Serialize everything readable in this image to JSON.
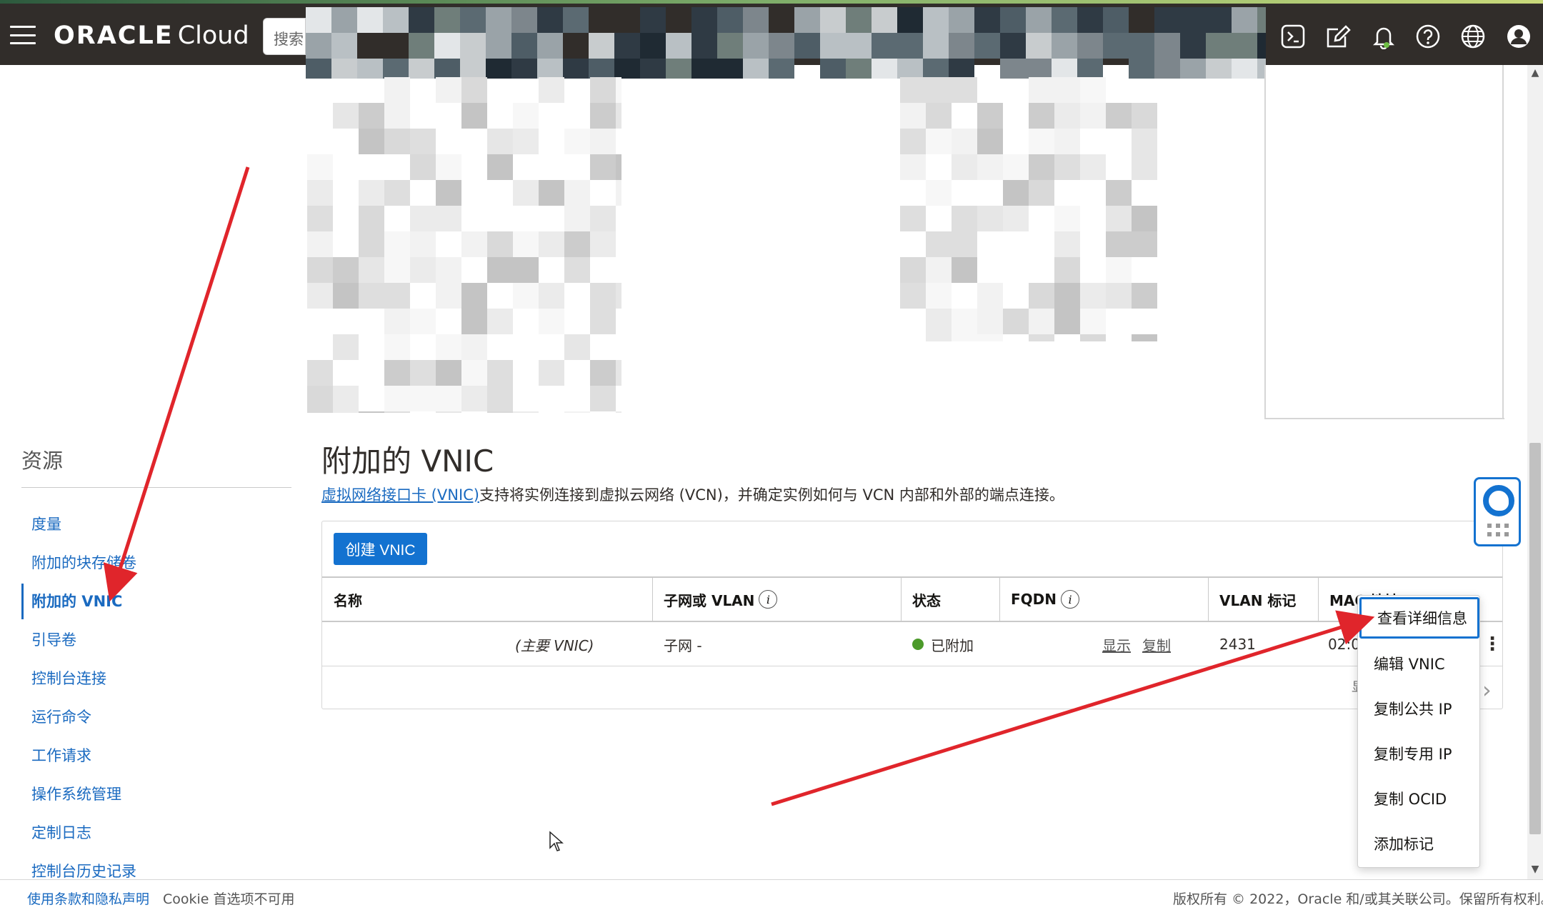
{
  "header": {
    "logo_brand": "ORACLE",
    "logo_product": "Cloud",
    "search_placeholder": "搜索",
    "icons": [
      "cloud-shell-icon",
      "edit-icon",
      "bell-icon",
      "help-icon",
      "globe-icon",
      "user-icon"
    ],
    "background_color": "#312d2a"
  },
  "sidebar": {
    "title": "资源",
    "items": [
      {
        "label": "度量",
        "active": false
      },
      {
        "label": "附加的块存储卷",
        "active": false
      },
      {
        "label": "附加的 VNIC",
        "active": true
      },
      {
        "label": "引导卷",
        "active": false
      },
      {
        "label": "控制台连接",
        "active": false
      },
      {
        "label": "运行命令",
        "active": false
      },
      {
        "label": "工作请求",
        "active": false
      },
      {
        "label": "操作系统管理",
        "active": false
      },
      {
        "label": "定制日志",
        "active": false
      },
      {
        "label": "控制台历史记录",
        "active": false
      }
    ]
  },
  "main": {
    "title": "附加的 VNIC",
    "desc_link": "虚拟网络接口卡 (VNIC)",
    "desc_rest": "支持将实例连接到虚拟云网络 (VCN)，并确定实例如何与 VCN 内部和外部的端点连接。",
    "create_button": "创建 VNIC",
    "table": {
      "headers": [
        "名称",
        "子网或 VLAN",
        "状态",
        "FQDN",
        "VLAN 标记",
        "MAC 地址"
      ],
      "rows": [
        {
          "name_suffix": "(主要 VNIC)",
          "subnet_prefix": "子网 -",
          "status": "已附加",
          "fqdn_show": "显示",
          "fqdn_copy": "复制",
          "vlan_tag": "2431",
          "mac_prefix": "02:0"
        }
      ],
      "pager_partial": "显"
    }
  },
  "context_menu": {
    "items": [
      "查看详细信息",
      "编辑 VNIC",
      "复制公共 IP",
      "复制专用 IP",
      "复制 OCID",
      "添加标记"
    ]
  },
  "footer": {
    "terms_link": "使用条款和隐私声明",
    "cookie_text": "Cookie 首选项不可用",
    "copyright": "版权所有 © 2022，Oracle 和/或其关联公司。保留所有权利。"
  },
  "colors": {
    "accent": "#1372d0",
    "link": "#1a6ac0",
    "status_attached": "#4c9a2a",
    "annotation_red": "#e0252b"
  }
}
